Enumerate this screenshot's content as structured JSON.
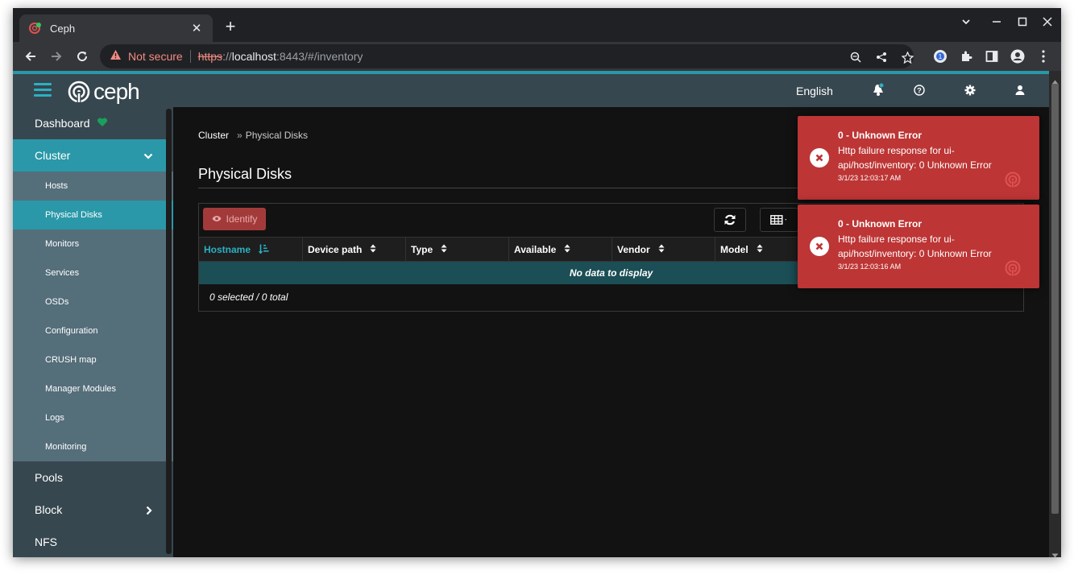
{
  "browser": {
    "tab_title": "Ceph",
    "security_label": "Not secure",
    "url_scheme": "https",
    "url_sep": "://",
    "url_host": "localhost",
    "url_rest": ":8443/#/inventory"
  },
  "header": {
    "logo_text": "ceph",
    "language": "English"
  },
  "sidebar": {
    "items": [
      {
        "label": "Dashboard"
      },
      {
        "label": "Cluster"
      },
      {
        "label": "Pools"
      },
      {
        "label": "Block"
      },
      {
        "label": "NFS"
      }
    ],
    "cluster_children": [
      {
        "label": "Hosts"
      },
      {
        "label": "Physical Disks"
      },
      {
        "label": "Monitors"
      },
      {
        "label": "Services"
      },
      {
        "label": "OSDs"
      },
      {
        "label": "Configuration"
      },
      {
        "label": "CRUSH map"
      },
      {
        "label": "Manager Modules"
      },
      {
        "label": "Logs"
      },
      {
        "label": "Monitoring"
      }
    ]
  },
  "breadcrumb": {
    "parent": "Cluster",
    "current": "Physical Disks"
  },
  "page_title": "Physical Disks",
  "table": {
    "identify_label": "Identify",
    "columns": [
      "Hostname",
      "Device path",
      "Type",
      "Available",
      "Vendor",
      "Model"
    ],
    "empty_text": "No data to display",
    "footer": "0 selected / 0 total"
  },
  "toasts": [
    {
      "title": "0 - Unknown Error",
      "message": "Http failure response for ui-api/host/inventory: 0 Unknown Error",
      "time": "3/1/23 12:03:17 AM"
    },
    {
      "title": "0 - Unknown Error",
      "message": "Http failure response for ui-api/host/inventory: 0 Unknown Error",
      "time": "3/1/23 12:03:16 AM"
    }
  ],
  "colors": {
    "accent": "#2a98a8",
    "toast_bg": "#bd3535",
    "nav_bg": "#37474f"
  }
}
